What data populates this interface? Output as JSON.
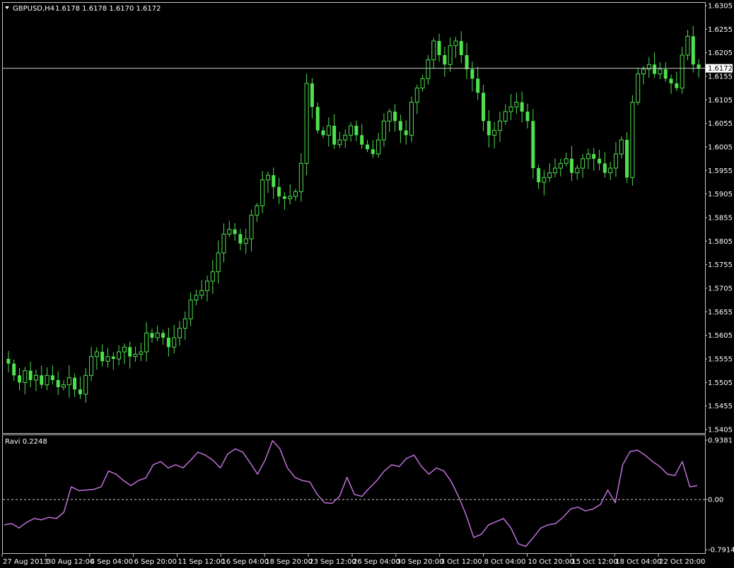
{
  "header": {
    "symbol": "GBPUSD,H4",
    "ohlc": "1.6178 1.6178 1.6170 1.6172"
  },
  "colors": {
    "background": "#000000",
    "candle": "#4fe04f",
    "indicator": "#c070d8",
    "level_line": "#c8c8c8",
    "text": "#ffffff"
  },
  "current_price_label": "1.6172",
  "indicator": {
    "label": "Ravi 0.2248",
    "top_label": "0.9381",
    "zero_label": "0.00",
    "bottom_label": "-0.7914"
  },
  "chart_data": [
    {
      "type": "candlestick",
      "title": "GBPUSD,H4",
      "ylim": [
        1.5405,
        1.6305
      ],
      "y_ticks": [
        "1.6305",
        "1.6255",
        "1.6205",
        "1.6155",
        "1.6105",
        "1.6055",
        "1.6005",
        "1.5955",
        "1.5905",
        "1.5855",
        "1.5805",
        "1.5755",
        "1.5705",
        "1.5655",
        "1.5605",
        "1.5555",
        "1.5505",
        "1.5455",
        "1.5405"
      ],
      "current_price": 1.6172,
      "close_series": [
        1.5545,
        1.552,
        1.5505,
        1.553,
        1.551,
        1.552,
        1.55,
        1.552,
        1.551,
        1.5495,
        1.55,
        1.5515,
        1.549,
        1.548,
        1.552,
        1.556,
        1.557,
        1.555,
        1.556,
        1.5555,
        1.557,
        1.558,
        1.556,
        1.5565,
        1.557,
        1.561,
        1.56,
        1.561,
        1.56,
        1.558,
        1.56,
        1.562,
        1.564,
        1.568,
        1.569,
        1.57,
        1.572,
        1.574,
        1.578,
        1.582,
        1.583,
        1.582,
        1.58,
        1.581,
        1.586,
        1.588,
        1.5935,
        1.5945,
        1.592,
        1.59,
        1.5895,
        1.59,
        1.591,
        1.597,
        1.614,
        1.609,
        1.604,
        1.603,
        1.605,
        1.601,
        1.602,
        1.603,
        1.605,
        1.603,
        1.601,
        1.6,
        1.599,
        1.602,
        1.606,
        1.608,
        1.606,
        1.604,
        1.603,
        1.61,
        1.613,
        1.615,
        1.619,
        1.623,
        1.62,
        1.618,
        1.622,
        1.623,
        1.62,
        1.617,
        1.615,
        1.612,
        1.606,
        1.603,
        1.604,
        1.606,
        1.608,
        1.609,
        1.61,
        1.608,
        1.606,
        1.596,
        1.593,
        1.594,
        1.595,
        1.596,
        1.597,
        1.598,
        1.595,
        1.596,
        1.598,
        1.599,
        1.598,
        1.597,
        1.595,
        1.596,
        1.599,
        1.602,
        1.594,
        1.61,
        1.616,
        1.617,
        1.618,
        1.616,
        1.617,
        1.615,
        1.614,
        1.613,
        1.62,
        1.624,
        1.618,
        1.6172
      ],
      "x_labels": [
        "27 Aug 2013",
        "30 Aug 12:00",
        "4 Sep 04:00",
        "6 Sep 20:00",
        "11 Sep 12:00",
        "16 Sep 04:00",
        "18 Sep 20:00",
        "23 Sep 12:00",
        "26 Sep 04:00",
        "30 Sep 20:00",
        "3 Oct 12:00",
        "8 Oct 04:00",
        "10 Oct 20:00",
        "15 Oct 12:00",
        "18 Oct 04:00",
        "22 Oct 20:00"
      ]
    },
    {
      "type": "line",
      "title": "Ravi 0.2248",
      "ylim": [
        -0.7914,
        0.9381
      ],
      "y_ticks": [
        "0.9381",
        "0.00",
        "-0.7914"
      ],
      "series": [
        {
          "values": [
            -0.4,
            -0.38,
            -0.45,
            -0.36,
            -0.3,
            -0.32,
            -0.28,
            -0.3,
            -0.2,
            0.2,
            0.14,
            0.15,
            0.16,
            0.2,
            0.45,
            0.4,
            0.3,
            0.22,
            0.3,
            0.34,
            0.55,
            0.6,
            0.5,
            0.55,
            0.5,
            0.62,
            0.75,
            0.7,
            0.62,
            0.5,
            0.72,
            0.8,
            0.75,
            0.58,
            0.4,
            0.62,
            0.93,
            0.8,
            0.5,
            0.35,
            0.3,
            0.28,
            0.08,
            -0.05,
            -0.06,
            0.05,
            0.35,
            0.08,
            0.05,
            0.18,
            0.3,
            0.45,
            0.55,
            0.52,
            0.65,
            0.7,
            0.52,
            0.4,
            0.5,
            0.45,
            0.28,
            0.04,
            -0.25,
            -0.6,
            -0.55,
            -0.4,
            -0.35,
            -0.3,
            -0.45,
            -0.7,
            -0.74,
            -0.6,
            -0.45,
            -0.4,
            -0.38,
            -0.28,
            -0.15,
            -0.12,
            -0.18,
            -0.15,
            -0.08,
            0.15,
            -0.05,
            0.55,
            0.76,
            0.78,
            0.7,
            0.6,
            0.52,
            0.4,
            0.38,
            0.6,
            0.2,
            0.22
          ]
        }
      ]
    }
  ]
}
